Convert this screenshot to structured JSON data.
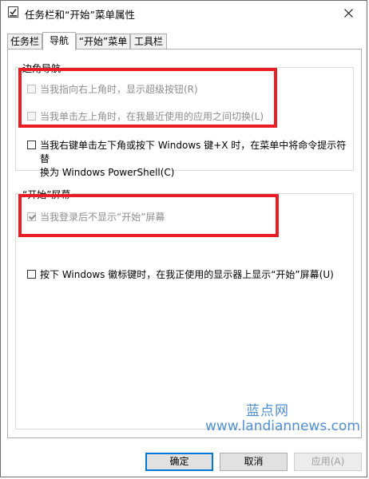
{
  "window": {
    "title": "任务栏和“开始”菜单属性"
  },
  "tabs": [
    {
      "label": "任务栏"
    },
    {
      "label": "导航"
    },
    {
      "label": "“开始”菜单"
    },
    {
      "label": "工具栏"
    }
  ],
  "active_tab": "导航",
  "corner_nav": {
    "title": "边角导航",
    "options": [
      {
        "label": "当我指向右上角时，显示超级按钮(R)",
        "checked": false,
        "disabled": true
      },
      {
        "label": "当我单击左上角时，在我最近使用的应用之间切换(L)",
        "checked": false,
        "disabled": true
      },
      {
        "label_line1": "当我右键单击左下角或按下 Windows 键+X 时，在菜单中将命令提示符替",
        "label_line2": "换为 Windows PowerShell(C)",
        "checked": false,
        "disabled": false
      }
    ]
  },
  "start_screen": {
    "title": "“开始”屏幕",
    "options": [
      {
        "label": "当我登录后不显示“开始”屏幕",
        "checked": true,
        "disabled": true
      },
      {
        "label": "按下 Windows 徽标键时，在我正使用的显示器上显示“开始”屏幕(U)",
        "checked": false,
        "disabled": false
      }
    ]
  },
  "watermark": {
    "cn": "蓝点网",
    "url": "www.landiannews.com"
  },
  "buttons": {
    "ok": "确定",
    "cancel": "取消",
    "apply": "应用(A)"
  },
  "colors": {
    "highlight_box": "#ea1c24",
    "accent": "#0078d7",
    "watermark": "#4e8fd6"
  }
}
